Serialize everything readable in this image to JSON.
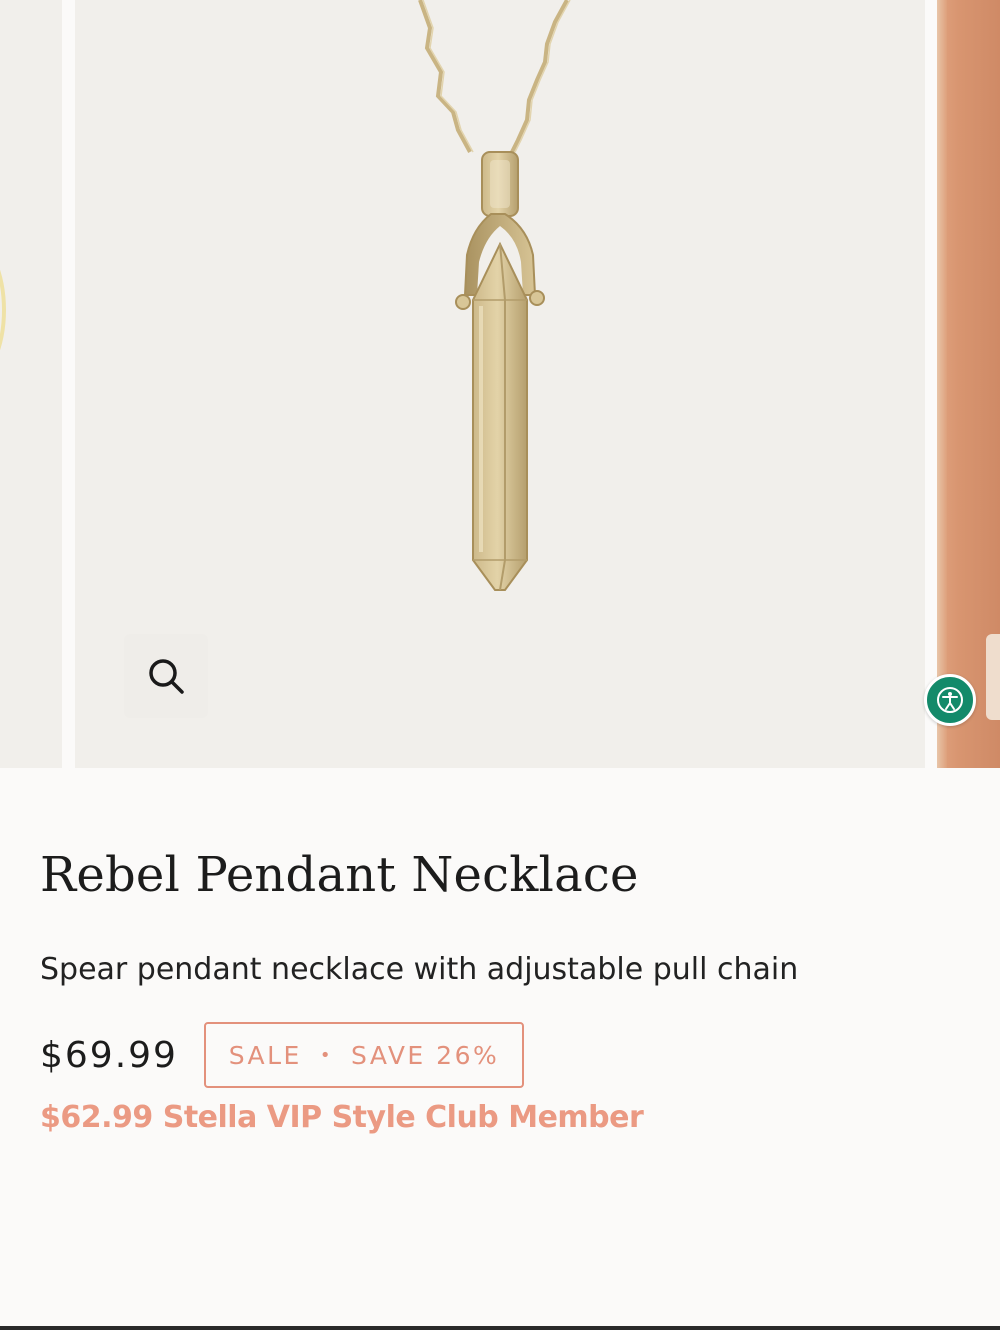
{
  "product": {
    "title": "Rebel Pendant Necklace",
    "description": "Spear pendant necklace with adjustable pull chain",
    "price": "$69.99",
    "sale_badge": {
      "label": "SALE",
      "separator": "•",
      "savings": "SAVE 26%"
    },
    "vip_price": "$62.99 Stella VIP Style Club Member"
  },
  "gallery": {
    "zoom_icon": "search-icon",
    "accessibility_icon": "accessibility-icon"
  },
  "colors": {
    "accent": "#e3917c",
    "vip_text": "#eb9a83",
    "accessibility_button": "#138a6a",
    "image_background": "#f1efeb"
  }
}
